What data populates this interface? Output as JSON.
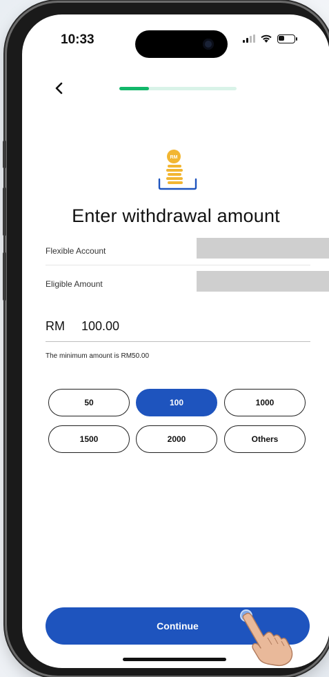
{
  "status": {
    "time": "10:33"
  },
  "progress": {
    "fraction": 0.25
  },
  "page": {
    "title": "Enter withdrawal amount"
  },
  "account": {
    "flexible_label": "Flexible Account",
    "eligible_label": "Eligible Amount"
  },
  "amount": {
    "currency": "RM",
    "value": "100.00"
  },
  "hint": "The minimum amount is RM50.00",
  "amount_options": [
    {
      "label": "50",
      "selected": false
    },
    {
      "label": "100",
      "selected": true
    },
    {
      "label": "1000",
      "selected": false
    },
    {
      "label": "1500",
      "selected": false
    },
    {
      "label": "2000",
      "selected": false
    },
    {
      "label": "Others",
      "selected": false
    }
  ],
  "coin_icon_text": "RM",
  "continue_label": "Continue",
  "colors": {
    "primary": "#1e54be",
    "progress": "#12b76a",
    "progress_track": "#d9f3e8",
    "coin": "#f2b632",
    "masked": "#cfcfcf"
  },
  "icons": {
    "back": "chevron-left-icon",
    "coin": "coin-stack-icon",
    "signal": "signal-icon",
    "wifi": "wifi-icon",
    "battery": "battery-icon",
    "pointer": "hand-pointer-icon"
  }
}
